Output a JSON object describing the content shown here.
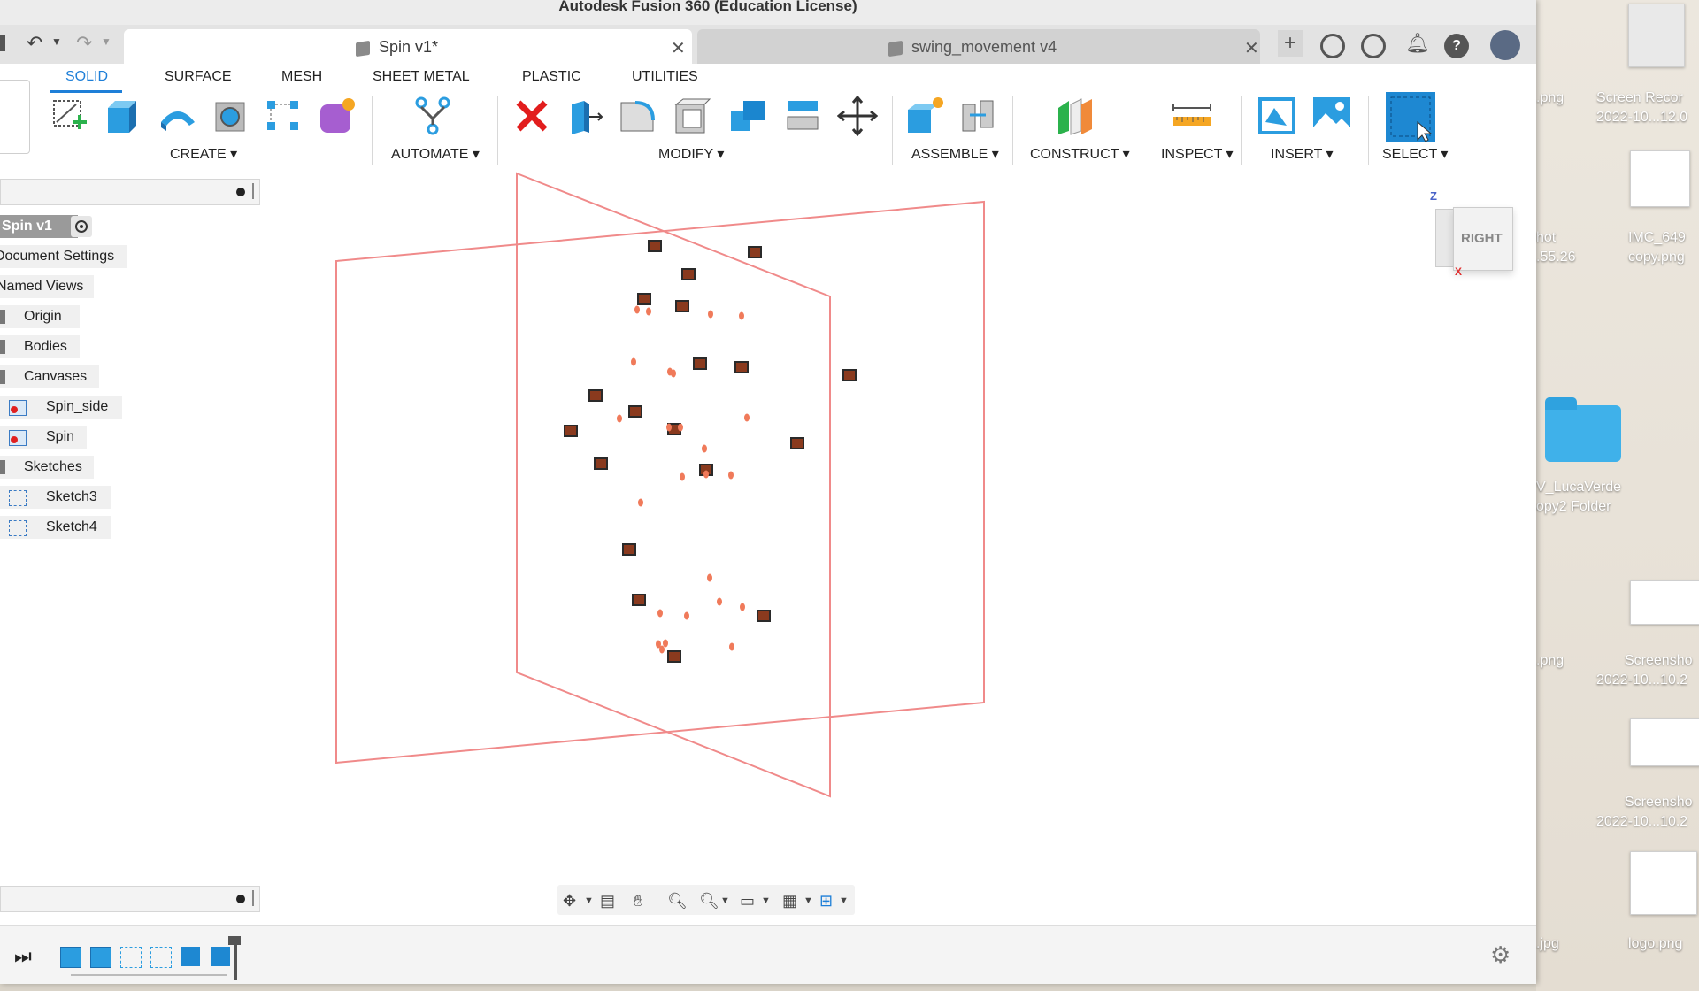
{
  "window_title": "Autodesk Fusion 360 (Education License)",
  "tabs": [
    {
      "label": "Spin v1*",
      "active": true
    },
    {
      "label": "swing_movement v4",
      "active": false
    }
  ],
  "ribbon_tabs": [
    "SOLID",
    "SURFACE",
    "MESH",
    "SHEET METAL",
    "PLASTIC",
    "UTILITIES"
  ],
  "ribbon_groups": [
    "CREATE ▾",
    "AUTOMATE ▾",
    "MODIFY ▾",
    "ASSEMBLE ▾",
    "CONSTRUCT ▾",
    "INSPECT ▾",
    "INSERT ▾",
    "SELECT ▾"
  ],
  "browser": {
    "root": "Spin v1",
    "items": [
      "Document Settings",
      "Named Views",
      "Origin",
      "Bodies",
      "Canvases",
      "Spin_side",
      "Spin",
      "Sketches",
      "Sketch3",
      "Sketch4"
    ]
  },
  "viewcube": {
    "face": "RIGHT",
    "axis_z": "Z",
    "axis_x": "X"
  },
  "desktop": {
    "items": [
      "Screen Recor",
      "2022-10...12.0",
      ".png",
      "IMC_649",
      "copy.png",
      "hot",
      ".55.26",
      "V_LucaVerde",
      "opy2 Folder",
      ".png",
      "Screensho",
      "2022-10...10.2",
      "Screensho",
      "2022-10...10.2",
      ".jpg",
      "logo.png"
    ]
  },
  "colors": {
    "accent": "#1e7fd8",
    "plane": "#f08a8a",
    "points": "#f07a5a"
  }
}
